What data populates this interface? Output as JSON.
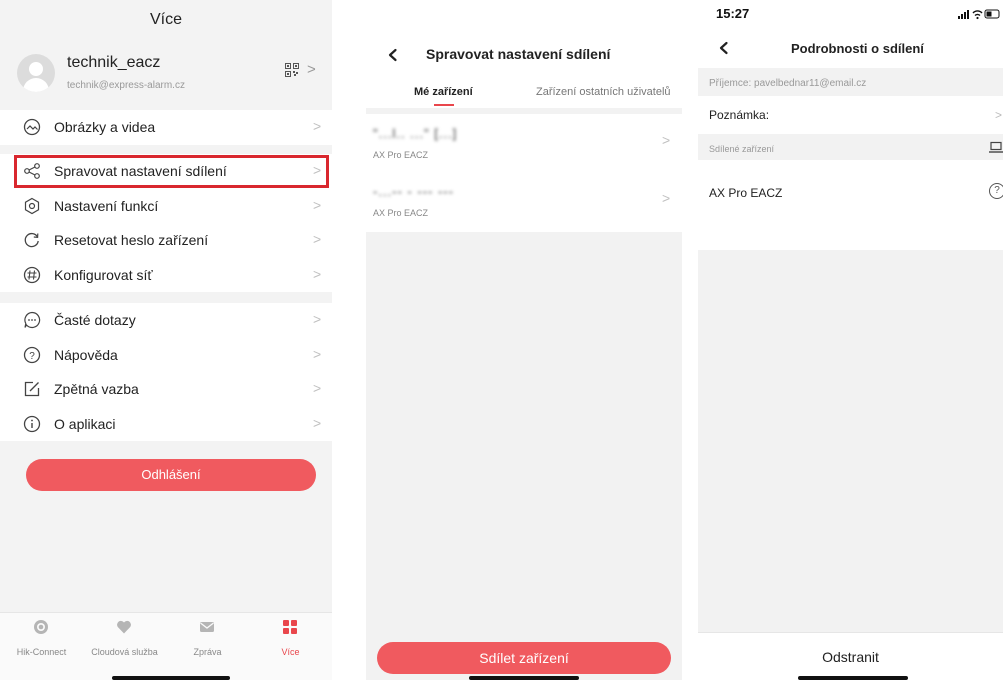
{
  "colors": {
    "accent": "#f05a5f",
    "highlight_border": "#d9272e",
    "active_tab": "#e9464c"
  },
  "more_screen": {
    "title": "Více",
    "profile": {
      "username": "technik_eacz",
      "email": "technik@express-alarm.cz",
      "qr_icon": "qr-code-icon",
      "chevron": ">"
    },
    "menu_groups": [
      [
        {
          "label": "Obrázky a videa",
          "icon": "media-icon"
        }
      ],
      [
        {
          "label": "Spravovat nastavení sdílení",
          "icon": "share-icon"
        },
        {
          "label": "Nastavení funkcí",
          "icon": "function-settings-icon"
        },
        {
          "label": "Resetovat heslo zařízení",
          "icon": "reset-icon"
        },
        {
          "label": "Konfigurovat síť",
          "icon": "network-icon"
        }
      ],
      [
        {
          "label": "Časté dotazy",
          "icon": "faq-icon"
        },
        {
          "label": "Nápověda",
          "icon": "help-icon"
        },
        {
          "label": "Zpětná vazba",
          "icon": "feedback-icon"
        },
        {
          "label": "O aplikaci",
          "icon": "info-icon"
        }
      ]
    ],
    "chevron": ">",
    "logout_label": "Odhlášení",
    "tabbar": [
      {
        "label": "Hik-Connect",
        "icon": "hik-connect-icon"
      },
      {
        "label": "Cloudová služba",
        "icon": "cloud-service-icon"
      },
      {
        "label": "Zpráva",
        "icon": "message-icon"
      },
      {
        "label": "Více",
        "icon": "more-grid-icon",
        "active": true
      }
    ]
  },
  "sharing_screen": {
    "title": "Spravovat nastavení sdílení",
    "tabs": {
      "active": "Mé zařízení",
      "other": "Zařízení ostatních uživatelů"
    },
    "devices": [
      {
        "name": "\"...l.. ...\" [...]",
        "model": "AX Pro EACZ"
      },
      {
        "name": "-...-- - --- ---",
        "model": "AX Pro EACZ"
      }
    ],
    "chevron": ">",
    "share_button": "Sdílet zařízení"
  },
  "details_screen": {
    "status_time": "15:27",
    "title": "Podrobnosti o sdílení",
    "recipient": "Příjemce: pavelbednar11@email.cz",
    "note_label": "Poznámka:",
    "chevron": ">",
    "shared_devices_label": "Sdílené zařízení",
    "device_name": "AX Pro  EACZ",
    "help_glyph": "?",
    "remove_label": "Odstranit"
  }
}
